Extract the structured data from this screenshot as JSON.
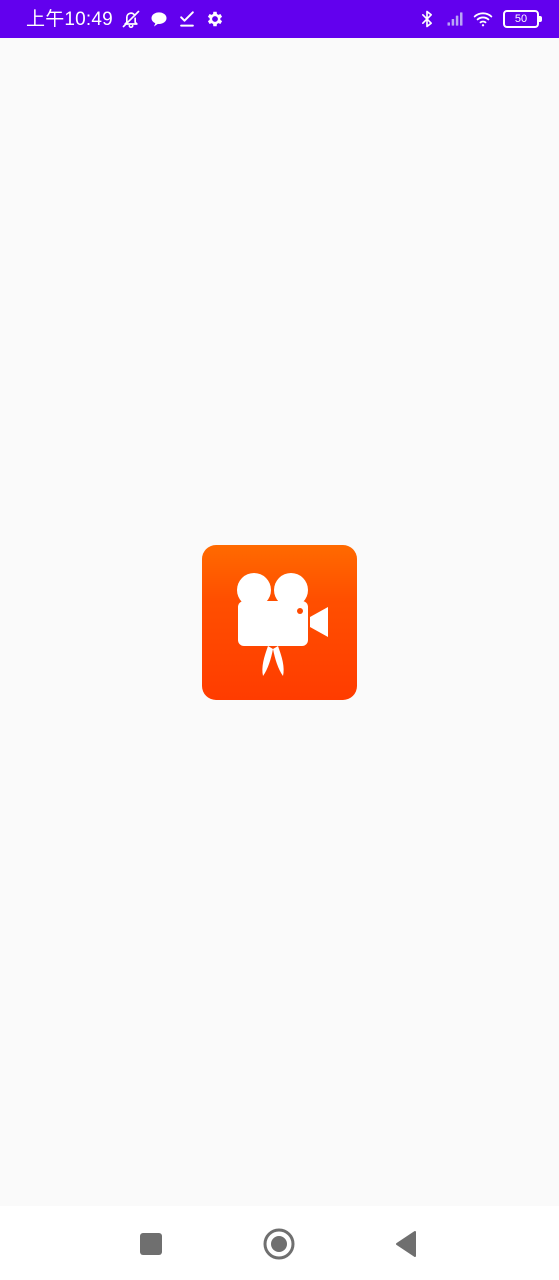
{
  "status_bar": {
    "time": "上午10:49",
    "battery_level": "50",
    "background_color": "#6200ee",
    "left_icons": [
      "alarm-off-icon",
      "chat-bubble-icon",
      "checklist-icon",
      "settings-gear-icon"
    ],
    "right_icons": [
      "bluetooth-icon",
      "cellular-signal-icon",
      "wifi-icon",
      "battery-icon"
    ]
  },
  "splash": {
    "logo_icon": "movie-camera-icon",
    "logo_gradient": [
      "#ff6a00",
      "#ff3c00"
    ],
    "background_color": "#fafafa"
  },
  "navigation_bar": {
    "buttons": [
      "recents-square-icon",
      "home-circle-icon",
      "back-triangle-icon"
    ]
  }
}
